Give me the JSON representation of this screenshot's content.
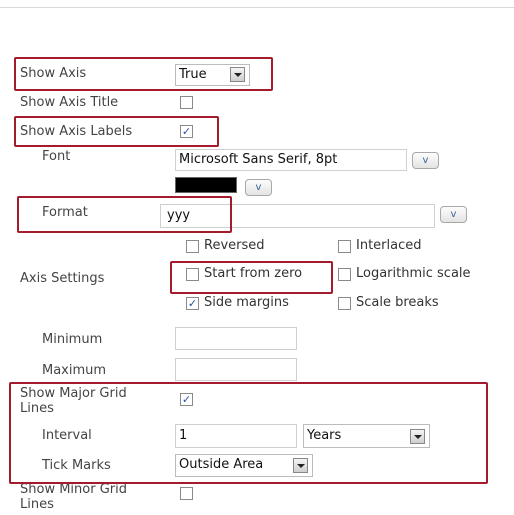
{
  "show_axis": {
    "label": "Show Axis",
    "value": "True"
  },
  "show_axis_title": {
    "label": "Show Axis Title",
    "checked": false
  },
  "show_axis_labels": {
    "label": "Show Axis Labels",
    "checked": true
  },
  "font": {
    "label": "Font",
    "value": "Microsoft Sans Serif, 8pt",
    "button": "v"
  },
  "color": {
    "swatch": "#000000",
    "button": "v"
  },
  "format": {
    "label": "Format",
    "value": "yyy",
    "button": "v"
  },
  "axis_settings": {
    "label": "Axis Settings",
    "options": [
      {
        "label": "Reversed",
        "checked": false
      },
      {
        "label": "Interlaced",
        "checked": false
      },
      {
        "label": "Start from zero",
        "checked": false
      },
      {
        "label": "Logarithmic scale",
        "checked": false
      },
      {
        "label": "Side margins",
        "checked": true
      },
      {
        "label": "Scale breaks",
        "checked": false
      }
    ]
  },
  "minimum": {
    "label": "Minimum",
    "value": ""
  },
  "maximum": {
    "label": "Maximum",
    "value": ""
  },
  "major_grid": {
    "label_line1": "Show Major Grid",
    "label_line2": "Lines",
    "checked": true,
    "interval_label": "Interval",
    "interval_value": "1",
    "interval_unit": "Years",
    "tick_marks_label": "Tick Marks",
    "tick_marks_value": "Outside Area"
  },
  "minor_grid": {
    "label_line1": "Show Minor Grid",
    "label_line2": "Lines",
    "checked": false
  },
  "colors": {
    "highlight": "#a31b2c",
    "check": "#2a4fa8"
  }
}
